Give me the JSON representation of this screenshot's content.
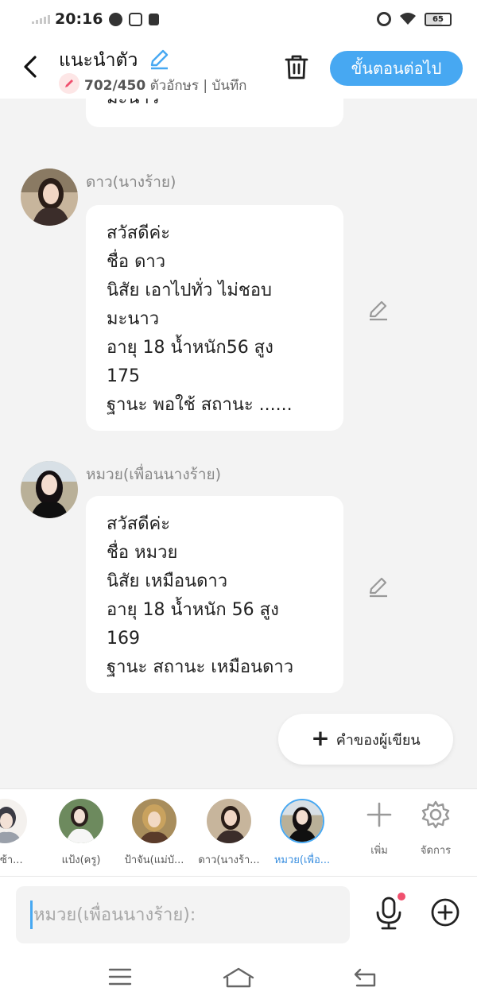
{
  "status_bar": {
    "time": "20:16",
    "battery": "65"
  },
  "header": {
    "title": "แนะนำตัว",
    "char_count": "702/450",
    "char_count_suffix": "ตัวอักษร | บันทึก",
    "next_button": "ขั้นตอนต่อไป"
  },
  "messages": {
    "partial": {
      "lines": [
        "มะนาว"
      ]
    },
    "dao": {
      "name": "ดาว(นางร้าย)",
      "lines": [
        "สวัสดีค่ะ",
        "ชื่อ ดาว",
        "นิสัย เอาไปทั่ว ไม่ชอบ",
        "มะนาว",
        "อายุ 18 น้ำหนัก56  สูง",
        "175",
        "ฐานะ พอใช้ สถานะ ......"
      ]
    },
    "muay": {
      "name": "หมวย(เพื่อนนางร้าย)",
      "lines": [
        "สวัสดีค่ะ",
        "ชื่อ หมวย",
        "นิสัย เหมือนดาว",
        "อายุ 18 น้ำหนัก 56 สูง",
        "169",
        "ฐานะ สถานะ เหมือนดาว"
      ]
    }
  },
  "author_button": {
    "label": "คำของผู้เขียน"
  },
  "characters": [
    {
      "name": "ซื่อซ้า..."
    },
    {
      "name": "แป้ง(ครู)"
    },
    {
      "name": "ป้าจัน(แม่บั..."
    },
    {
      "name": "ดาว(นางร้า..."
    },
    {
      "name": "หมวย(เพื่อ..."
    }
  ],
  "tools": {
    "add": "เพิ่ม",
    "manage": "จัดการ"
  },
  "input": {
    "placeholder": "หมวย(เพื่อนนางร้าย):"
  },
  "colors": {
    "accent": "#47a8f2",
    "background": "#f3f3f3",
    "notification_dot": "#f0506e"
  }
}
